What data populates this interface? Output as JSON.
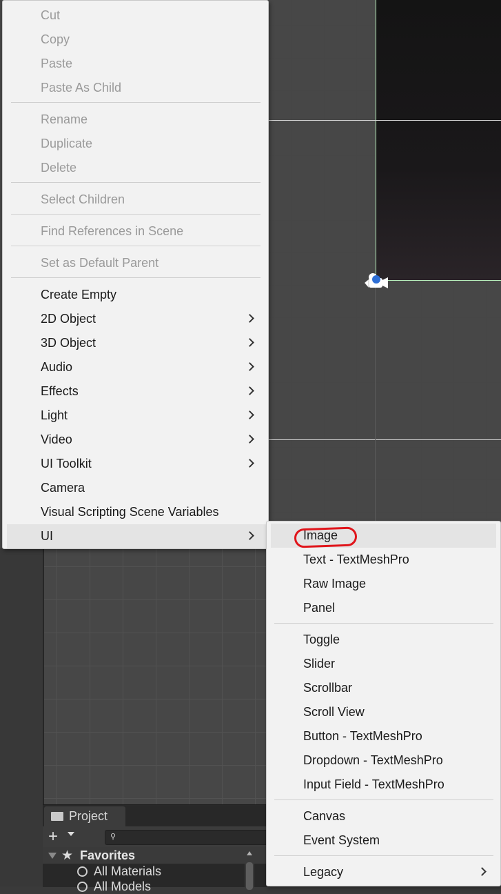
{
  "context_menu": {
    "items": [
      {
        "label": "Cut",
        "enabled": false
      },
      {
        "label": "Copy",
        "enabled": false
      },
      {
        "label": "Paste",
        "enabled": false
      },
      {
        "label": "Paste As Child",
        "enabled": false
      },
      {
        "label": "Rename",
        "enabled": false
      },
      {
        "label": "Duplicate",
        "enabled": false
      },
      {
        "label": "Delete",
        "enabled": false
      },
      {
        "label": "Select Children",
        "enabled": false
      },
      {
        "label": "Find References in Scene",
        "enabled": false
      },
      {
        "label": "Set as Default Parent",
        "enabled": false
      },
      {
        "label": "Create Empty",
        "enabled": true
      },
      {
        "label": "2D Object",
        "enabled": true,
        "submenu": true
      },
      {
        "label": "3D Object",
        "enabled": true,
        "submenu": true
      },
      {
        "label": "Audio",
        "enabled": true,
        "submenu": true
      },
      {
        "label": "Effects",
        "enabled": true,
        "submenu": true
      },
      {
        "label": "Light",
        "enabled": true,
        "submenu": true
      },
      {
        "label": "Video",
        "enabled": true,
        "submenu": true
      },
      {
        "label": "UI Toolkit",
        "enabled": true,
        "submenu": true
      },
      {
        "label": "Camera",
        "enabled": true
      },
      {
        "label": "Visual Scripting Scene Variables",
        "enabled": true
      },
      {
        "label": "UI",
        "enabled": true,
        "submenu": true,
        "highlighted": true
      }
    ]
  },
  "ui_submenu": {
    "items": [
      {
        "label": "Image",
        "highlighted": true,
        "annotated": true
      },
      {
        "label": "Text - TextMeshPro"
      },
      {
        "label": "Raw Image"
      },
      {
        "label": "Panel"
      },
      {
        "label": "Toggle"
      },
      {
        "label": "Slider"
      },
      {
        "label": "Scrollbar"
      },
      {
        "label": "Scroll View"
      },
      {
        "label": "Button - TextMeshPro"
      },
      {
        "label": "Dropdown - TextMeshPro"
      },
      {
        "label": "Input Field - TextMeshPro"
      },
      {
        "label": "Canvas"
      },
      {
        "label": "Event System"
      },
      {
        "label": "Legacy",
        "submenu": true
      }
    ]
  },
  "project_panel": {
    "tab_label": "Project",
    "add_label": "+",
    "favorites_label": "Favorites",
    "favorites_items": [
      "All Materials",
      "All Models"
    ]
  },
  "colors": {
    "menu_bg": "#f2f2f2",
    "menu_hover": "#e4e4e4",
    "disabled_text": "#9a9a9a",
    "annotation": "#e0151b",
    "scene_bg": "#474747",
    "game_frame_border": "#b9f2bd"
  },
  "icons": {
    "submenu_arrow": "chevron-right-icon",
    "camera_gizmo": "camera-icon",
    "search": "search-icon",
    "folder": "folder-icon",
    "favorites": "star-icon"
  }
}
